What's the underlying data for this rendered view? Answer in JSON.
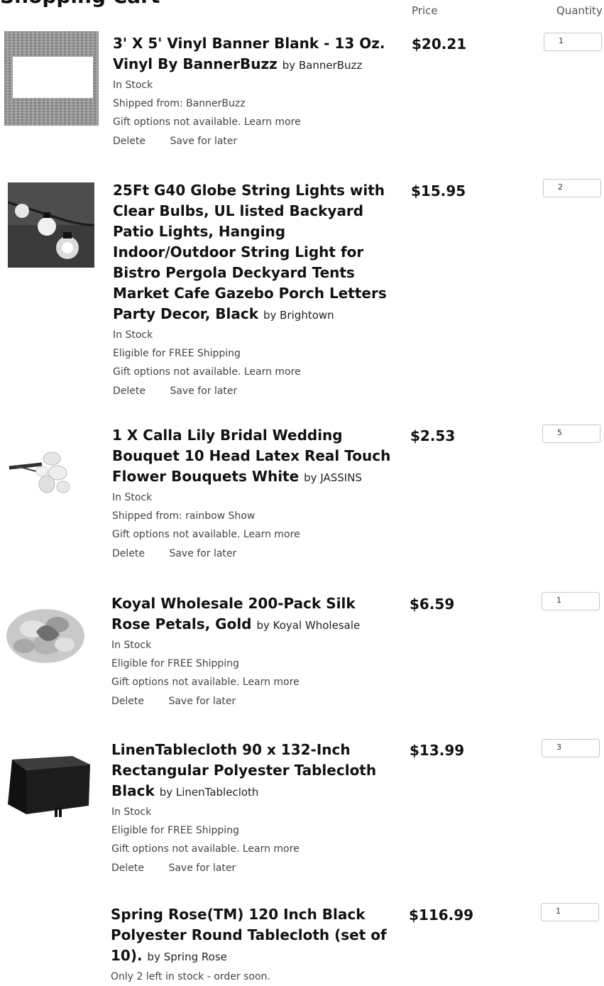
{
  "page": {
    "heading": "Shopping Cart"
  },
  "columns": {
    "price": "Price",
    "quantity": "Quantity"
  },
  "actions": {
    "delete": "Delete",
    "save": "Save for later"
  },
  "items": [
    {
      "title": "3' X 5' Vinyl Banner Blank - 13 Oz. Vinyl By BannerBuzz",
      "by": "by BannerBuzz",
      "stock": "In Stock",
      "shipping": "Shipped from: BannerBuzz",
      "gift": "Gift options not available. Learn more",
      "price": "$20.21",
      "qty": "1"
    },
    {
      "title": "25Ft G40 Globe String Lights with Clear Bulbs, UL listed Backyard Patio Lights, Hanging Indoor/Outdoor String Light for Bistro Pergola Deckyard Tents Market Cafe Gazebo Porch Letters Party Decor, Black",
      "by": "by Brightown",
      "stock": "In Stock",
      "shipping": "Eligible for FREE Shipping",
      "gift": "Gift options not available. Learn more",
      "price": "$15.95",
      "qty": "2"
    },
    {
      "title": "1 X Calla Lily Bridal Wedding Bouquet 10 Head Latex Real Touch Flower Bouquets White",
      "by": "by JASSINS",
      "stock": "In Stock",
      "shipping": "Shipped from: rainbow Show",
      "gift": "Gift options not available. Learn more",
      "price": "$2.53",
      "qty": "5"
    },
    {
      "title": "Koyal Wholesale 200-Pack Silk Rose Petals, Gold",
      "by": "by Koyal Wholesale",
      "stock": "In Stock",
      "shipping": "Eligible for FREE Shipping",
      "gift": "Gift options not available. Learn more",
      "price": "$6.59",
      "qty": "1"
    },
    {
      "title": "LinenTablecloth 90 x 132-Inch Rectangular Polyester Tablecloth Black",
      "by": "by LinenTablecloth",
      "stock": "In Stock",
      "shipping": "Eligible for FREE Shipping",
      "gift": "Gift options not available. Learn more",
      "price": "$13.99",
      "qty": "3"
    },
    {
      "title": "Spring Rose(TM) 120 Inch Black Polyester Round Tablecloth (set of 10).",
      "by": "by Spring Rose",
      "stock": "Only 2 left in stock - order soon.",
      "price": "$116.99",
      "qty": "1"
    }
  ]
}
